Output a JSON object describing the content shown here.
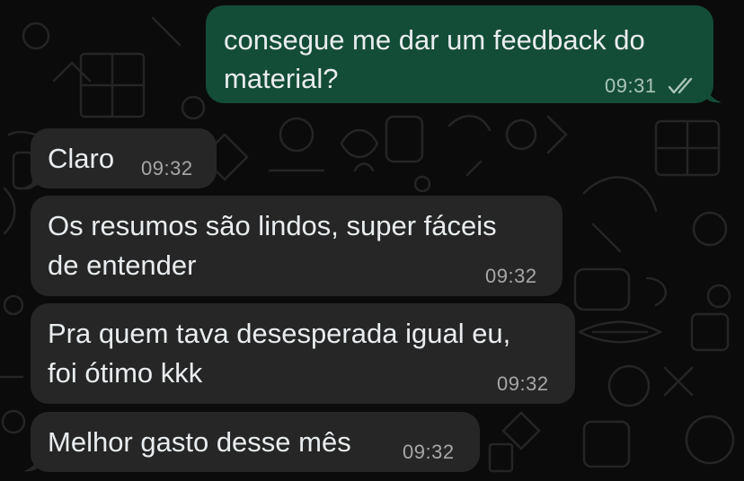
{
  "theme": {
    "background": "#0b0b0b",
    "incoming_bubble": "#262626",
    "outgoing_bubble": "#144d37",
    "text": "#e9edef",
    "timestamp": "#a7a7a7"
  },
  "messages": [
    {
      "direction": "outgoing",
      "lines": [
        "consegue me dar um feedback do",
        "material?"
      ],
      "time": "09:31",
      "status_icon": "double-check-icon"
    },
    {
      "direction": "incoming",
      "lines": [
        "Claro"
      ],
      "time": "09:32"
    },
    {
      "direction": "incoming",
      "lines": [
        "Os resumos são lindos, super fáceis",
        "de entender"
      ],
      "time": "09:32"
    },
    {
      "direction": "incoming",
      "lines": [
        "Pra quem tava desesperada igual eu,",
        "foi ótimo kkk"
      ],
      "time": "09:32"
    },
    {
      "direction": "incoming",
      "lines": [
        "Melhor gasto desse mês"
      ],
      "time": "09:32"
    }
  ]
}
